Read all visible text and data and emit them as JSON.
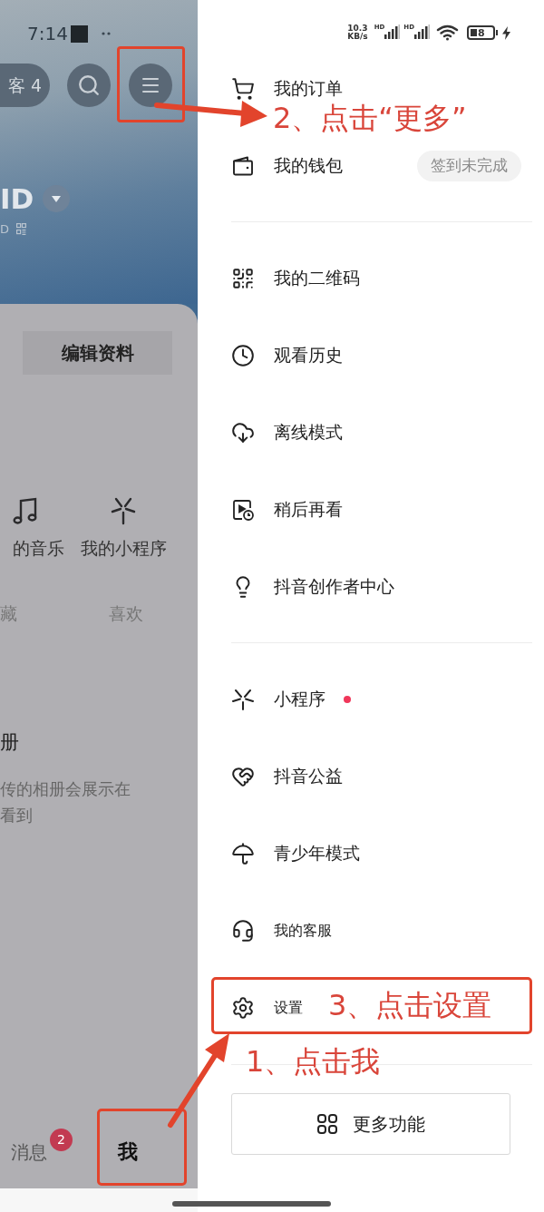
{
  "profile": {
    "status_time": "7:14",
    "visitor_pill": "客 4",
    "id_name": "ID",
    "id_sub": "D",
    "edit_button": "编辑资料",
    "shortcuts": [
      {
        "label": "的音乐"
      },
      {
        "label": "我的小程序"
      }
    ],
    "tabs": [
      {
        "label": "藏",
        "selected": false
      },
      {
        "label": "喜欢",
        "selected": false
      }
    ],
    "album": {
      "title": "册",
      "lines": [
        "传的相册会展示在",
        "看到"
      ]
    },
    "nav": [
      {
        "label": "消息",
        "badge": "2",
        "selected": false
      },
      {
        "label": "我",
        "selected": true
      }
    ]
  },
  "status_bar": {
    "speed": "10.3",
    "speed_unit": "KB/s",
    "networks": [
      "HD",
      "HD"
    ],
    "battery": "8"
  },
  "drawer": {
    "sections": [
      [
        {
          "label": "我的订单",
          "unread": false
        },
        {
          "label": "我的钱包",
          "badge": "签到未完成",
          "unread": false
        }
      ],
      [
        {
          "label": "我的二维码",
          "unread": false
        },
        {
          "label": "观看历史",
          "unread": false
        },
        {
          "label": "离线模式",
          "unread": false
        },
        {
          "label": "稍后再看",
          "unread": false
        },
        {
          "label": "抖音创作者中心",
          "unread": false
        }
      ],
      [
        {
          "label": "小程序",
          "unread": true
        },
        {
          "label": "抖音公益",
          "unread": false
        },
        {
          "label": "青少年模式",
          "unread": false
        },
        {
          "label": "我的客服",
          "unread": false
        },
        {
          "label": "设置",
          "unread": false
        }
      ]
    ],
    "more_button": "更多功能"
  },
  "annotations": {
    "menu_step": "2、点击“更多”",
    "settings_step": "3、点击设置",
    "me_step": "1、点击我"
  }
}
